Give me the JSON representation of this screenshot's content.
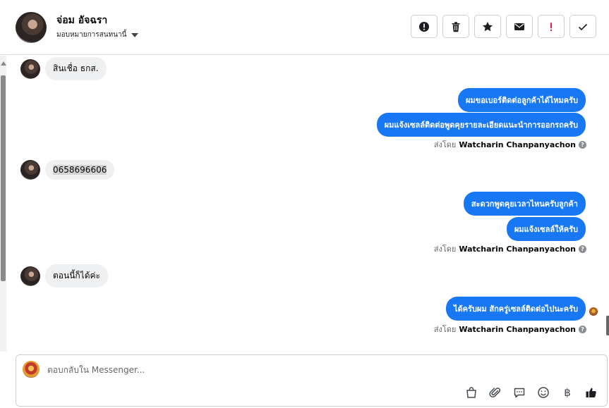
{
  "header": {
    "contact_name": "จ่อม อัจฉรา",
    "assign_label": "มอบหมายการสนทนานี้"
  },
  "toolbar": [
    {
      "name": "mark-spam-button",
      "icon": "alert-circle-icon"
    },
    {
      "name": "delete-button",
      "icon": "trash-icon"
    },
    {
      "name": "star-button",
      "icon": "star-icon"
    },
    {
      "name": "mark-unread-button",
      "icon": "envelope-icon"
    },
    {
      "name": "mark-important-button",
      "icon": "exclamation-icon"
    },
    {
      "name": "mark-done-button",
      "icon": "check-icon"
    }
  ],
  "messages": {
    "m1": "สินเชื่อ ธกส.",
    "m2": "ผมขอเบอร์ติดต่อลูกค้าได้ไหมครับ",
    "m3": "ผมแจ้งเซลล์ติดต่อพูดคุยรายละเอียดแนะนำการออกรถครับ",
    "m4": "0658696606",
    "m5": "สะดวกพูดคุยเวลาไหนครับลูกค้า",
    "m6": "ผมแจ้งเซลล์ให้ครับ",
    "m7": "ตอนนี้ก็ได้ค่ะ",
    "m8": "ได้ครับผม สักครู่เซลล์ติดต่อไปนะครับ"
  },
  "sent_by": {
    "prefix": "ส่งโดย",
    "agent": "Watcharin Chanpanyachon"
  },
  "composer": {
    "placeholder": "ตอบกลับใน Messenger..."
  },
  "colors": {
    "outgoing_bubble": "#1877f2",
    "incoming_bubble": "#eff0f1",
    "important": "#e41e3f"
  }
}
